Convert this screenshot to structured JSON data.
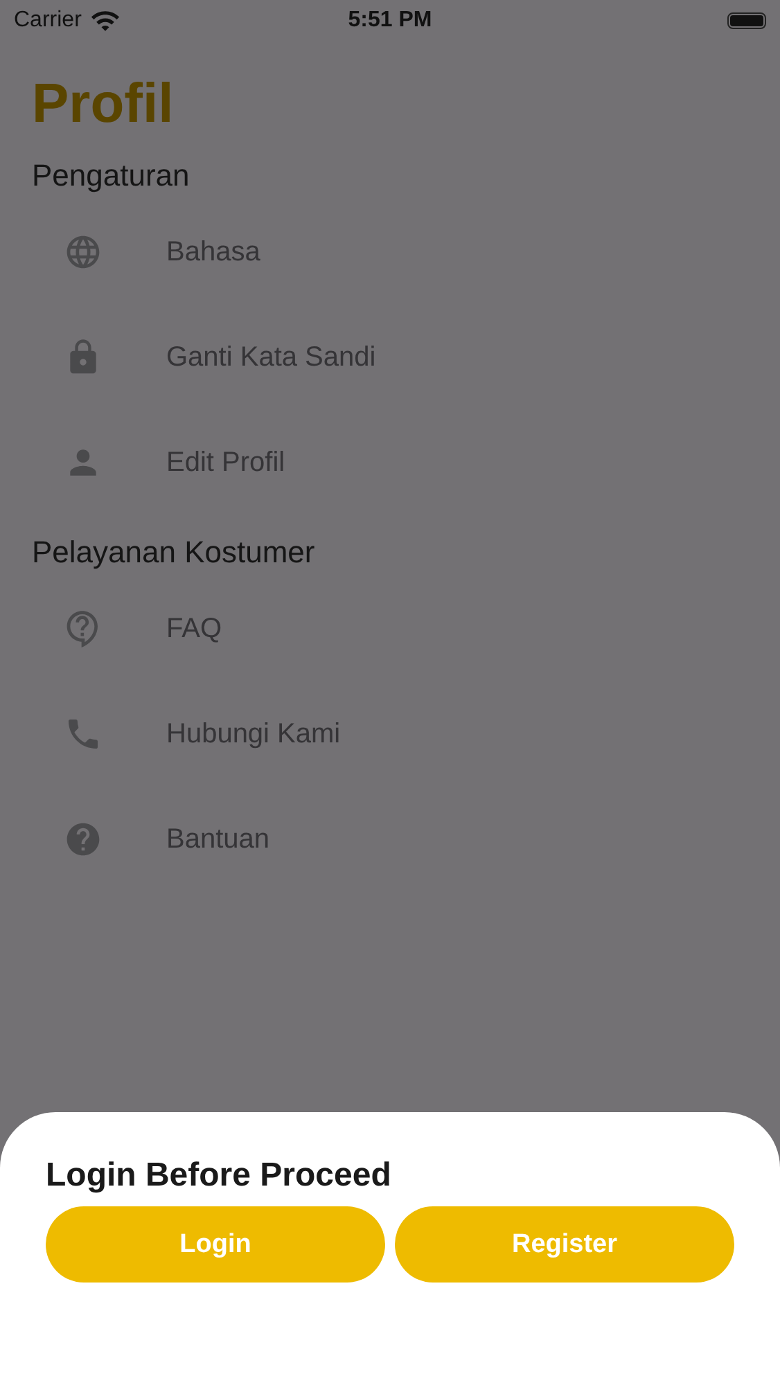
{
  "status_bar": {
    "carrier": "Carrier",
    "time": "5:51 PM"
  },
  "title": "Profil",
  "sections": [
    {
      "title": "Pengaturan",
      "items": [
        {
          "label": "Bahasa"
        },
        {
          "label": "Ganti Kata Sandi"
        },
        {
          "label": "Edit Profil"
        }
      ]
    },
    {
      "title": "Pelayanan Kostumer",
      "items": [
        {
          "label": "FAQ"
        },
        {
          "label": "Hubungi Kami"
        },
        {
          "label": "Bantuan"
        }
      ]
    }
  ],
  "sheet": {
    "title": "Login Before Proceed",
    "buttons": [
      "Login",
      "Register"
    ]
  }
}
